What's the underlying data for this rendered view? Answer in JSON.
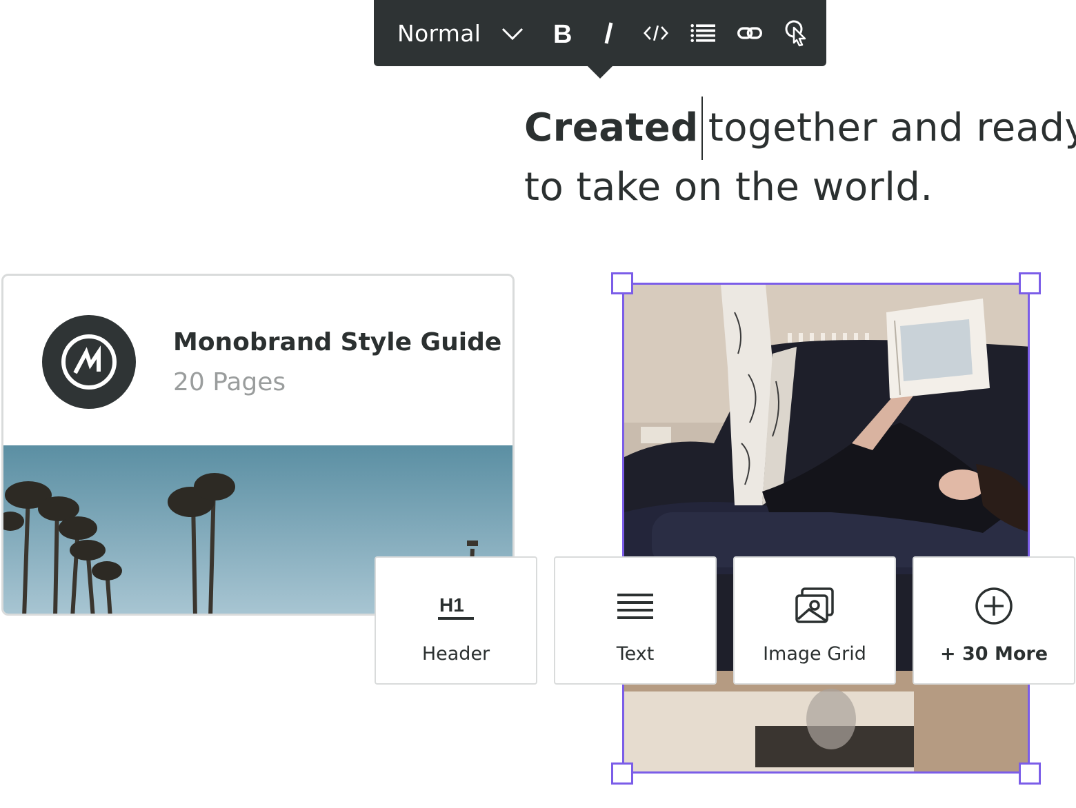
{
  "toolbar": {
    "style_value": "Normal",
    "buttons": [
      "bold-icon",
      "italic-icon",
      "code-icon",
      "list-icon",
      "link-icon",
      "pointer-icon"
    ]
  },
  "headline": {
    "selected_word": "Created",
    "line1_rest": "together and ready",
    "line2": "to take on the world."
  },
  "card": {
    "title": "Monobrand Style Guide",
    "subtitle": "20 Pages",
    "logo_icon": "monobrand-logo"
  },
  "blocks": {
    "header_icon_text": "H1",
    "header_label": "Header",
    "text_label": "Text",
    "image_grid_label": "Image Grid",
    "more_label": "+ 30 More"
  },
  "colors": {
    "toolbar_bg": "#2e3334",
    "selection_accent": "#7b5de8",
    "text": "#2b3030",
    "muted": "#9a9d9d"
  }
}
